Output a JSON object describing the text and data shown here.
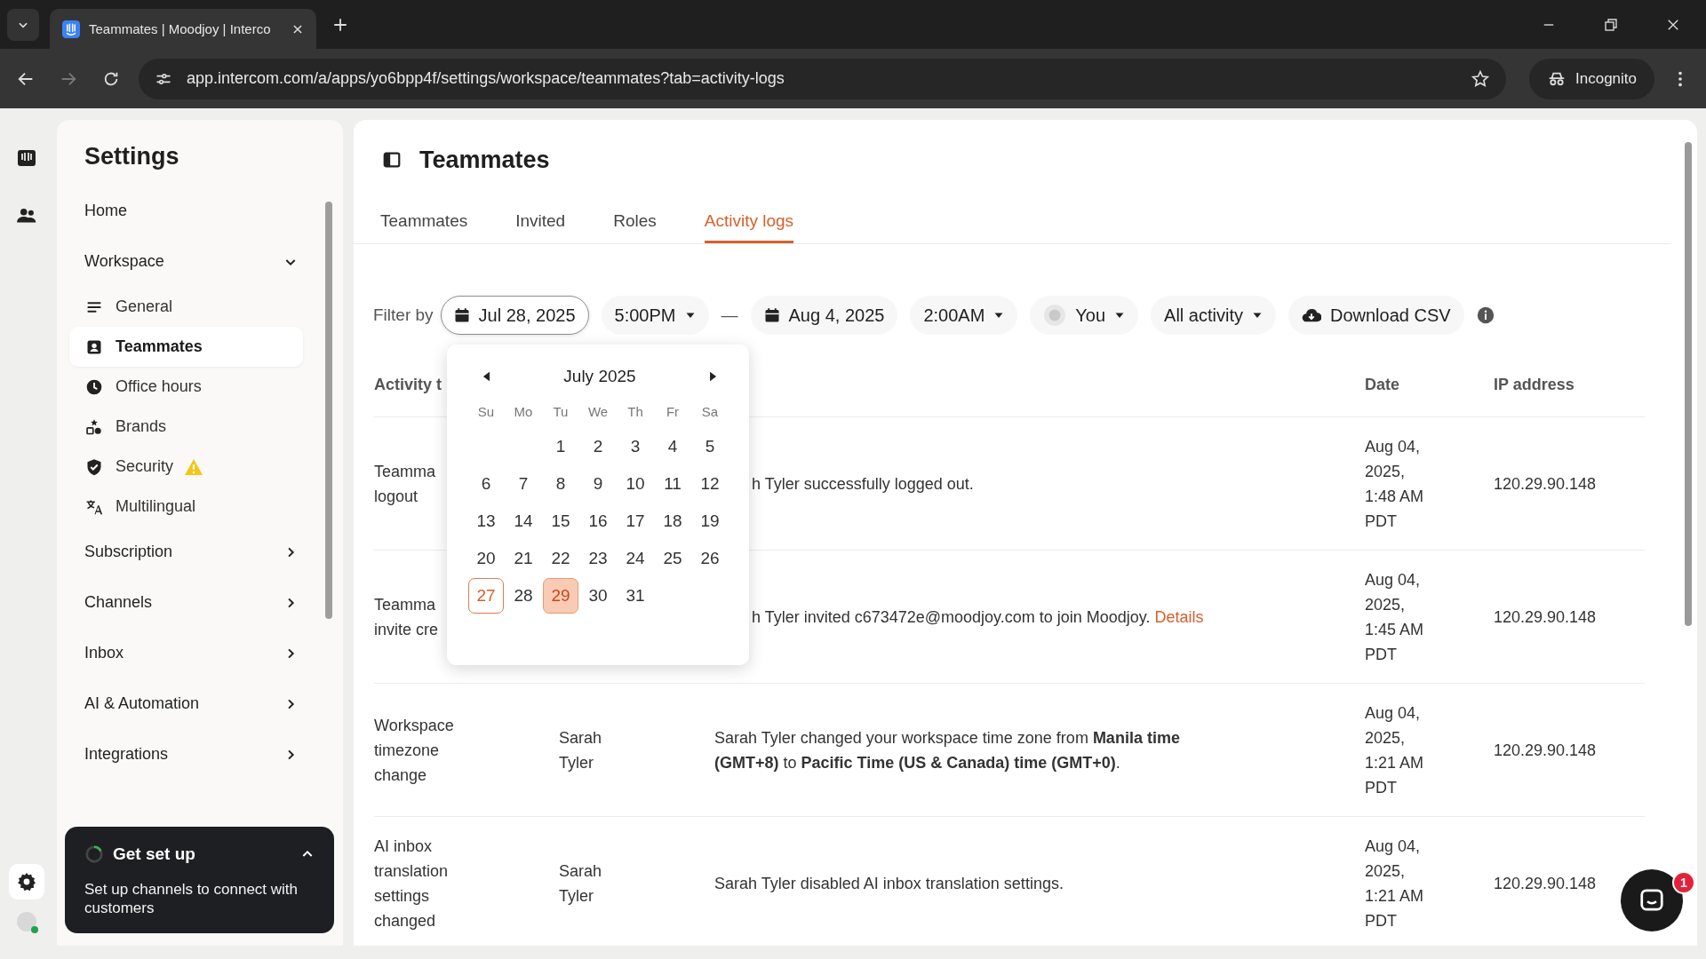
{
  "browser": {
    "tab_title": "Teammates | Moodjoy | Interco",
    "url": "app.intercom.com/a/apps/yo6bpp4f/settings/workspace/teammates?tab=activity-logs",
    "profile": "Incognito"
  },
  "sidebar": {
    "title": "Settings",
    "items": [
      {
        "label": "Home"
      },
      {
        "label": "Workspace",
        "expanded": true,
        "children": [
          {
            "label": "General",
            "selected": false,
            "warning": false
          },
          {
            "label": "Teammates",
            "selected": true,
            "warning": false
          },
          {
            "label": "Office hours",
            "selected": false,
            "warning": false
          },
          {
            "label": "Brands",
            "selected": false,
            "warning": false
          },
          {
            "label": "Security",
            "selected": false,
            "warning": true
          },
          {
            "label": "Multilingual",
            "selected": false,
            "warning": false
          }
        ]
      },
      {
        "label": "Subscription",
        "expanded": false
      },
      {
        "label": "Channels",
        "expanded": false
      },
      {
        "label": "Inbox",
        "expanded": false
      },
      {
        "label": "AI & Automation",
        "expanded": false
      },
      {
        "label": "Integrations",
        "expanded": false
      }
    ]
  },
  "setup_card": {
    "title": "Get set up",
    "text": "Set up channels to connect with customers",
    "expanded": true
  },
  "page": {
    "title": "Teammates",
    "tabs": [
      {
        "label": "Teammates",
        "selected": false
      },
      {
        "label": "Invited",
        "selected": false
      },
      {
        "label": "Roles",
        "selected": false
      },
      {
        "label": "Activity logs",
        "selected": true
      }
    ],
    "filter": {
      "label": "Filter by",
      "start_date": {
        "label": "Jul 28, 2025",
        "open": true
      },
      "start_time": "5:00PM",
      "separator": "—",
      "end_date": {
        "label": "Aug 4, 2025",
        "open": false
      },
      "end_time": "2:00AM",
      "person": "You",
      "activity": "All activity",
      "download": "Download CSV"
    },
    "calendar": {
      "month": "July 2025",
      "weekdays": [
        "Su",
        "Mo",
        "Tu",
        "We",
        "Th",
        "Fr",
        "Sa"
      ],
      "weeks": [
        {
          "kind": "partial",
          "days": [
            {
              "label": "1",
              "selected": false,
              "hovered": false
            },
            {
              "label": "2",
              "selected": false,
              "hovered": false
            },
            {
              "label": "3",
              "selected": false,
              "hovered": false
            },
            {
              "label": "4",
              "selected": false,
              "hovered": false
            },
            {
              "label": "5",
              "selected": false,
              "hovered": false
            }
          ]
        },
        {
          "kind": "full",
          "days": [
            {
              "label": "6",
              "selected": false,
              "hovered": false
            },
            {
              "label": "7",
              "selected": false,
              "hovered": false
            },
            {
              "label": "8",
              "selected": false,
              "hovered": false
            },
            {
              "label": "9",
              "selected": false,
              "hovered": false
            },
            {
              "label": "10",
              "selected": false,
              "hovered": false
            },
            {
              "label": "11",
              "selected": false,
              "hovered": false
            },
            {
              "label": "12",
              "selected": false,
              "hovered": false
            }
          ]
        },
        {
          "kind": "full",
          "days": [
            {
              "label": "13",
              "selected": false,
              "hovered": false
            },
            {
              "label": "14",
              "selected": false,
              "hovered": false
            },
            {
              "label": "15",
              "selected": false,
              "hovered": false
            },
            {
              "label": "16",
              "selected": false,
              "hovered": false
            },
            {
              "label": "17",
              "selected": false,
              "hovered": false
            },
            {
              "label": "18",
              "selected": false,
              "hovered": false
            },
            {
              "label": "19",
              "selected": false,
              "hovered": false
            }
          ]
        },
        {
          "kind": "full",
          "days": [
            {
              "label": "20",
              "selected": false,
              "hovered": false
            },
            {
              "label": "21",
              "selected": false,
              "hovered": false
            },
            {
              "label": "22",
              "selected": false,
              "hovered": false
            },
            {
              "label": "23",
              "selected": false,
              "hovered": false
            },
            {
              "label": "24",
              "selected": false,
              "hovered": false
            },
            {
              "label": "25",
              "selected": false,
              "hovered": false
            },
            {
              "label": "26",
              "selected": false,
              "hovered": false
            }
          ]
        },
        {
          "kind": "full",
          "days": [
            {
              "label": "27",
              "selected": false,
              "hovered": true
            },
            {
              "label": "28",
              "selected": false,
              "hovered": false
            },
            {
              "label": "29",
              "selected": true,
              "hovered": false
            },
            {
              "label": "30",
              "selected": false,
              "hovered": false
            },
            {
              "label": "31",
              "selected": false,
              "hovered": false
            }
          ]
        }
      ]
    },
    "table": {
      "columns": [
        "Activity t",
        "Date",
        "IP address"
      ],
      "rows": [
        {
          "activity": [
            "Teamma",
            "logout"
          ],
          "description": "h Tyler successfully logged out.",
          "cut": true,
          "date": [
            "Aug 04,",
            "2025,",
            "1:48 AM",
            "PDT"
          ],
          "ip": "120.29.90.148"
        },
        {
          "activity": [
            "Teamma",
            "invite cre"
          ],
          "description": "h Tyler invited c673472e@moodjoy.com to join Moodjoy.",
          "link": "Details",
          "cut": true,
          "date": [
            "Aug 04,",
            "2025,",
            "1:45 AM",
            "PDT"
          ],
          "ip": "120.29.90.148"
        },
        {
          "activity": [
            "Workspace",
            "timezone",
            "change"
          ],
          "performer": [
            "Sarah",
            "Tyler"
          ],
          "description": "Sarah Tyler changed your workspace time zone from **Manila time (GMT+8)** to **Pacific Time (US & Canada) time (GMT+0)**.",
          "cut": false,
          "date": [
            "Aug 04,",
            "2025,",
            "1:21 AM",
            "PDT"
          ],
          "ip": "120.29.90.148"
        },
        {
          "activity": [
            "AI inbox",
            "translation",
            "settings",
            "changed"
          ],
          "performer": [
            "Sarah",
            "Tyler"
          ],
          "description": "Sarah Tyler disabled AI inbox translation settings.",
          "cut": false,
          "date": [
            "Aug 04,",
            "2025,",
            "1:21 AM",
            "PDT"
          ],
          "ip": "120.29.90.148"
        }
      ]
    }
  },
  "chat": {
    "badge": "1"
  }
}
